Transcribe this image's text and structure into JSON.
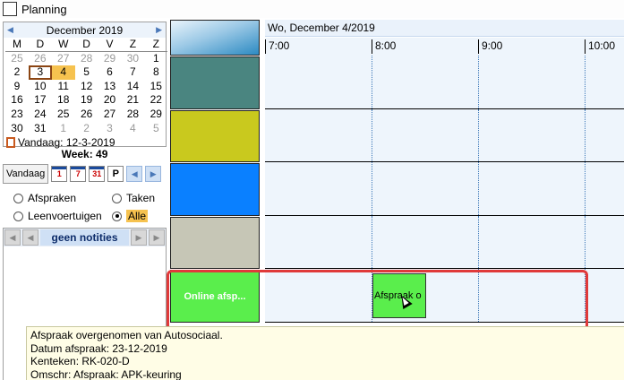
{
  "window": {
    "title": "Planning"
  },
  "calendar": {
    "month_title": "December 2019",
    "weekdays": [
      "M",
      "D",
      "W",
      "D",
      "V",
      "Z",
      "Z"
    ],
    "weeks": [
      [
        "25",
        "26",
        "27",
        "28",
        "29",
        "30",
        "1"
      ],
      [
        "2",
        "3",
        "4",
        "5",
        "6",
        "7",
        "8"
      ],
      [
        "9",
        "10",
        "11",
        "12",
        "13",
        "14",
        "15"
      ],
      [
        "16",
        "17",
        "18",
        "19",
        "20",
        "21",
        "22"
      ],
      [
        "23",
        "24",
        "25",
        "26",
        "27",
        "28",
        "29"
      ],
      [
        "30",
        "31",
        "1",
        "2",
        "3",
        "4",
        "5"
      ]
    ],
    "today_label": "Vandaag: 12-3-2019"
  },
  "week_label": "Week: 49",
  "toolbar": {
    "today_button": "Vandaag",
    "day_button": "1",
    "week_button": "7",
    "month_button": "31",
    "print_button": "P"
  },
  "filters": {
    "appointments": "Afspraken",
    "tasks": "Taken",
    "loan_vehicles": "Leenvoertuigen",
    "all": "Alle",
    "selected": "Alle"
  },
  "notes": {
    "label": "geen notities"
  },
  "planner": {
    "date_header": "Wo, December 4/2019",
    "times": [
      "7:00",
      "8:00",
      "9:00",
      "10:00"
    ],
    "resources": [
      {
        "label": "",
        "color": "#4a8580"
      },
      {
        "label": "",
        "color": "#c9c91e"
      },
      {
        "label": "",
        "color": "#0a80ff"
      },
      {
        "label": "",
        "color": "#c6c6b6"
      },
      {
        "label": "Online afsp...",
        "color": "#5aee4c"
      }
    ],
    "appointment": {
      "label": "Afspraak o",
      "color": "#5aee4c"
    }
  },
  "tooltip": {
    "lines": [
      "Afspraak overgenomen van Autosociaal.",
      "Datum afspraak: 23-12-2019",
      "Kenteken: RK-020-D",
      "Omschr: Afspraak: APK-keuring"
    ]
  }
}
